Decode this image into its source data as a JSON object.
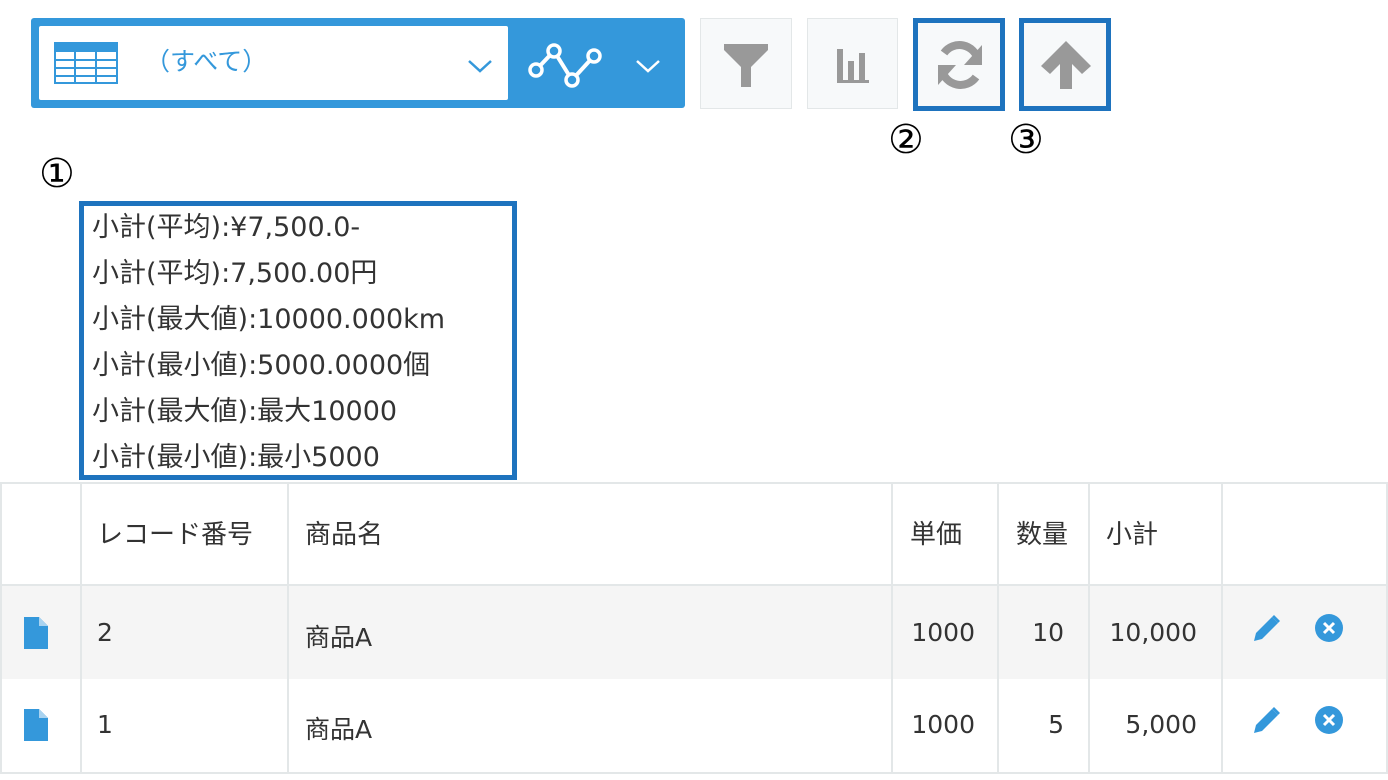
{
  "toolbar": {
    "view_label": "（すべて）",
    "icons": {
      "view": "table-view-icon",
      "view_chevron": "chevron-down-icon",
      "graph": "line-graph-icon",
      "graph_chevron": "chevron-down-icon",
      "filter": "filter-icon",
      "chart": "bar-chart-icon",
      "refresh": "refresh-icon",
      "upload": "up-arrow-icon"
    }
  },
  "annotations": {
    "n1": "①",
    "n2": "②",
    "n3": "③",
    "color": "#1e73be"
  },
  "aggregates": [
    "小計(平均):¥7,500.0-",
    "小計(平均):7,500.00円",
    "小計(最大値):10000.000km",
    "小計(最小値):5000.0000個",
    "小計(最大値):最大10000",
    "小計(最小値):最小5000"
  ],
  "table": {
    "headers": {
      "record_no": "レコード番号",
      "product": "商品名",
      "unit_price": "単価",
      "quantity": "数量",
      "subtotal": "小計"
    },
    "rows": [
      {
        "record_no": "2",
        "product": "商品A",
        "unit_price": "1000",
        "quantity": "10",
        "subtotal": "10,000"
      },
      {
        "record_no": "1",
        "product": "商品A",
        "unit_price": "1000",
        "quantity": "5",
        "subtotal": "5,000"
      }
    ]
  },
  "colors": {
    "accent": "#3498db",
    "row_alt": "#f5f5f5",
    "icon_gray": "#999999"
  }
}
